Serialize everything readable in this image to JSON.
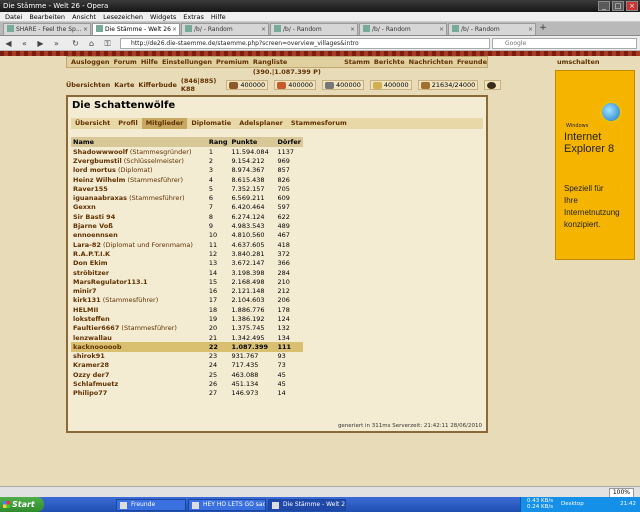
{
  "browser": {
    "title": "Die Stämme - Welt 26 - Opera",
    "menu": [
      "Datei",
      "Bearbeiten",
      "Ansicht",
      "Lesezeichen",
      "Widgets",
      "Extras",
      "Hilfe"
    ],
    "tabs": [
      "SHARE - Feel the Sp...",
      "Die Stämme - Welt 26",
      "/b/ - Random",
      "/b/ - Random",
      "/b/ - Random",
      "/b/ - Random"
    ],
    "url": "http://de26.die-staemme.de/staemme.php?screen=overview_villages&intro",
    "search_placeholder": "Google",
    "zoom": "100%"
  },
  "topnav": [
    "Ausloggen",
    "Forum",
    "Hilfe",
    "Einstellungen",
    "Premium",
    "Rangliste (390.|1.087.399 P)",
    "Stamm",
    "Berichte",
    "Nachrichten",
    "Freunde"
  ],
  "village": {
    "links": [
      "Übersichten",
      "Karte",
      "Kifferbude"
    ],
    "coords": "(846|885) K88"
  },
  "resources": {
    "wood": "400000",
    "clay": "400000",
    "iron": "400000",
    "farm": "400000",
    "storage": "21634/24000"
  },
  "tribe": {
    "title": "Die Schattenwölfe",
    "subnav": [
      "Übersicht",
      "Profil",
      "Mitglieder",
      "Diplomatie",
      "Adelsplaner",
      "Stammesforum"
    ],
    "selected": "Mitglieder",
    "headers": [
      "Name",
      "Rang",
      "Punkte",
      "Dörfer"
    ],
    "members": [
      {
        "name": "Shadowwwoolf",
        "role": " (Stammesgründer)",
        "rank": "1",
        "points": "11.594.084",
        "villages": "1137"
      },
      {
        "name": "Zvergbumstil",
        "role": " (Schlüsselmeister)",
        "rank": "2",
        "points": "9.154.212",
        "villages": "969"
      },
      {
        "name": "lord mortus",
        "role": " (Diplomat)",
        "rank": "3",
        "points": "8.974.367",
        "villages": "857"
      },
      {
        "name": "Heinz Wilhelm",
        "role": " (Stammesführer)",
        "rank": "4",
        "points": "8.615.438",
        "villages": "826"
      },
      {
        "name": "Raver155",
        "role": "",
        "rank": "5",
        "points": "7.352.157",
        "villages": "705"
      },
      {
        "name": "iguanaabraxas",
        "role": " (Stammesführer)",
        "rank": "6",
        "points": "6.569.211",
        "villages": "609"
      },
      {
        "name": "Gexxn",
        "role": "",
        "rank": "7",
        "points": "6.420.464",
        "villages": "597"
      },
      {
        "name": "Sir Basti 94",
        "role": "",
        "rank": "8",
        "points": "6.274.124",
        "villages": "622"
      },
      {
        "name": "Bjarne Voß",
        "role": "",
        "rank": "9",
        "points": "4.983.543",
        "villages": "489"
      },
      {
        "name": "ennoennsen",
        "role": "",
        "rank": "10",
        "points": "4.810.560",
        "villages": "467"
      },
      {
        "name": "Lara-82",
        "role": " (Diplomat und Forenmama)",
        "rank": "11",
        "points": "4.637.605",
        "villages": "418"
      },
      {
        "name": "R.A.P.T.I.K",
        "role": "",
        "rank": "12",
        "points": "3.840.281",
        "villages": "372"
      },
      {
        "name": "Don Ekim",
        "role": "",
        "rank": "13",
        "points": "3.672.147",
        "villages": "366"
      },
      {
        "name": "ströbitzer",
        "role": "",
        "rank": "14",
        "points": "3.198.398",
        "villages": "284"
      },
      {
        "name": "MarsRegulator113.1",
        "role": "",
        "rank": "15",
        "points": "2.168.498",
        "villages": "210"
      },
      {
        "name": "minir7",
        "role": "",
        "rank": "16",
        "points": "2.121.148",
        "villages": "212"
      },
      {
        "name": "kirk131",
        "role": " (Stammesführer)",
        "rank": "17",
        "points": "2.104.603",
        "villages": "206"
      },
      {
        "name": "HELMII",
        "role": "",
        "rank": "18",
        "points": "1.886.776",
        "villages": "178"
      },
      {
        "name": "loksteffen",
        "role": "",
        "rank": "19",
        "points": "1.386.192",
        "villages": "124"
      },
      {
        "name": "Faultier6667",
        "role": " (Stammesführer)",
        "rank": "20",
        "points": "1.375.745",
        "villages": "132"
      },
      {
        "name": "lenzwallau",
        "role": "",
        "rank": "21",
        "points": "1.342.495",
        "villages": "134"
      },
      {
        "name": "kacknooooob",
        "role": "",
        "rank": "22",
        "points": "1.087.399",
        "villages": "111"
      },
      {
        "name": "shirok91",
        "role": "",
        "rank": "23",
        "points": "931.767",
        "villages": "93"
      },
      {
        "name": "Kramer28",
        "role": "",
        "rank": "24",
        "points": "717.435",
        "villages": "73"
      },
      {
        "name": "Ozzy der7",
        "role": "",
        "rank": "25",
        "points": "463.088",
        "villages": "45"
      },
      {
        "name": "Schlafmuetz",
        "role": "",
        "rank": "26",
        "points": "451.134",
        "villages": "45"
      },
      {
        "name": "Philipo77",
        "role": "",
        "rank": "27",
        "points": "146.973",
        "villages": "14"
      }
    ],
    "footer": "generiert in 311ms Serverzeit: 21:42:11 28/06/2010"
  },
  "ad": {
    "toggle": "umschalten",
    "windows": "Windows",
    "title1": "Internet",
    "title2": "Explorer 8",
    "text": [
      "Speziell für",
      "Ihre",
      "Internetnutzung",
      "konzipiert."
    ]
  },
  "taskbar": {
    "start": "Start",
    "items": [
      "Freunde",
      "HEY HO LETS GO sad...",
      "Die Stämme - Welt 26 ..."
    ],
    "net1": "0.43 KB/s",
    "net2": "0.24 KB/s",
    "desktop": "Desktop",
    "clock": "21:42"
  }
}
